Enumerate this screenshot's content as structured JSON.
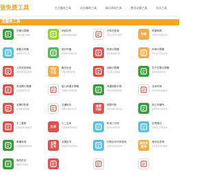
{
  "header": {
    "logo": "张免费工具",
    "nav": [
      "生活服务工具",
      "站长辅助工具",
      "娱乐休闲工具",
      "数学计算工具",
      "站长工具"
    ]
  },
  "section": {
    "title": "活服务工具"
  },
  "tools": [
    [
      {
        "name": "日期计算器",
        "desc": "时间天数计算器",
        "icon": "calendar-icon",
        "color": "#3a9b3a"
      },
      {
        "name": "闹钟计时",
        "desc": "在线闹钟定时提醒",
        "icon": "alarm-clock-icon",
        "color": "#9bd23c"
      },
      {
        "name": "万年历查询",
        "desc": "农历公历节日黄历",
        "icon": "calendar-grid-icon",
        "color": "#ffffff"
      },
      {
        "name": "时差换算",
        "desc": "世界时间时区查询",
        "icon": "time-zone-icon",
        "color": "#f0ad4e",
        "label": "时差"
      }
    ],
    [
      {
        "name": "倒数计时器",
        "desc": "在线倒计时工具",
        "icon": "stopwatch-icon",
        "color": "#5bc0de"
      },
      {
        "name": "倒计时器",
        "desc": "在线倒计时器工具",
        "icon": "green-clock-icon",
        "color": "#5cb85c"
      },
      {
        "name": "时间计算器",
        "desc": "时间差加减计算",
        "icon": "clock-icon",
        "color": "#d9534f"
      },
      {
        "name": "年龄计算器",
        "desc": "周岁虚岁生肖计算",
        "icon": "age-icon",
        "color": "#f0ad4e"
      }
    ],
    [
      {
        "name": "公历农历转换",
        "desc": "阴历阳历相互转换",
        "icon": "lunar-calendar-icon",
        "color": "#d9534f"
      },
      {
        "name": "假日大全",
        "desc": "节假日放假安排",
        "icon": "holiday-icon",
        "color": "#f0ad4e",
        "label": "知识\n大全"
      },
      {
        "name": "油耗计算器",
        "desc": "汽车百公里油耗",
        "icon": "fuel-pump-icon",
        "color": "#d9534f"
      },
      {
        "name": "生产日期计算器",
        "desc": "保质期到期查询",
        "icon": "production-date-icon",
        "color": "#3a9b3a"
      }
    ],
    [
      {
        "name": "安全期计算器",
        "desc": "女性经期安全期",
        "icon": "safe-period-icon",
        "color": "#d9534f"
      },
      {
        "name": "胎儿体重计算器",
        "desc": "孕期胎儿体重估算",
        "icon": "fetus-icon",
        "color": "#ffffff"
      },
      {
        "name": "体重指数计算",
        "desc": "BMI身体质量指数",
        "icon": "bmi-icon",
        "color": "#3a9b3a"
      },
      {
        "name": "北京时间",
        "desc": "北京时间在线校准",
        "icon": "beijing-time-icon",
        "color": "#ffffff"
      }
    ],
    [
      {
        "name": "名牌约吃券",
        "desc": "优惠券在线领取",
        "icon": "coupon-icon",
        "color": "#d9534f"
      },
      {
        "name": "交通标志",
        "desc": "道路交通标志大全",
        "icon": "traffic-sign-icon",
        "color": "#ffffff"
      },
      {
        "name": "违章代码",
        "desc": "交通违章代码查询",
        "icon": "violation-code-icon",
        "color": "#d9534f",
        "label": "违章\n代码"
      },
      {
        "name": "网上车管所",
        "desc": "车辆年检违章查询",
        "icon": "car-icon",
        "color": "#3a9b3a"
      }
    ],
    [
      {
        "name": "十二星座",
        "desc": "星座运势性格查询",
        "icon": "zodiac-icon",
        "color": "#d9534f"
      },
      {
        "name": "十二生肖",
        "desc": "生肖属相年份查询",
        "icon": "chinese-zodiac-icon",
        "color": "#d9534f",
        "label": "生肖"
      },
      {
        "name": "机场三字码",
        "desc": "国内外机场代码",
        "icon": "airport-icon",
        "color": "#5bc0de"
      },
      {
        "name": "世界港口",
        "desc": "全球港口代码查询",
        "icon": "port-icon",
        "color": "#5bc0de"
      }
    ],
    [
      {
        "name": "邮编查询",
        "desc": "全国邮政编码查询",
        "icon": "postal-icon",
        "color": "#3a9b3a"
      },
      {
        "name": "全国区号",
        "desc": "电话区号在线查询",
        "icon": "area-code-icon",
        "color": "#d9534f",
        "label": "全国\n区号"
      },
      {
        "name": "行政区划代码查询",
        "desc": "全国行政区划代码",
        "icon": "region-code-icon",
        "color": "#5bc0de"
      },
      {
        "name": "身份证查询",
        "desc": "身份证号码归属地",
        "icon": "id-card-icon",
        "color": "#f0ad4e",
        "label": "身份证\n查询"
      }
    ],
    [
      {
        "name": "佛历历法",
        "desc": "佛教历法查询",
        "icon": "buddhist-calendar-icon",
        "color": "#3a9b3a"
      },
      {
        "name": "",
        "desc": "",
        "icon": "wheel-icon",
        "color": "#d9534f"
      },
      {
        "name": "",
        "desc": "",
        "icon": "blank-icon",
        "color": "#ffffff"
      },
      {
        "name": "",
        "desc": "",
        "icon": "blank-icon",
        "color": "#ffffff"
      }
    ]
  ]
}
